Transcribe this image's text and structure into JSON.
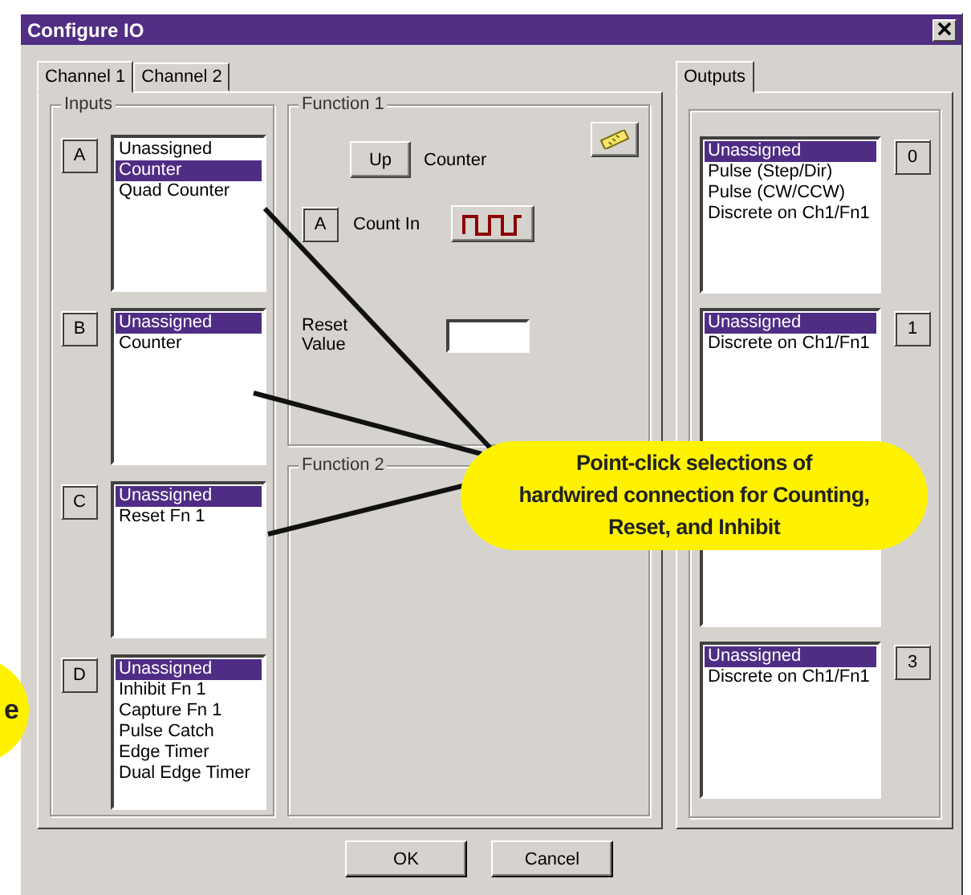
{
  "window": {
    "title": "Configure IO"
  },
  "tabs": [
    {
      "label": "Channel 1",
      "selected": true
    },
    {
      "label": "Channel 2",
      "selected": false
    }
  ],
  "inputs": {
    "title": "Inputs",
    "rows": [
      {
        "key": "A",
        "items": [
          {
            "label": "Unassigned",
            "selected": false
          },
          {
            "label": "Counter",
            "selected": true
          },
          {
            "label": "Quad Counter",
            "selected": false
          }
        ]
      },
      {
        "key": "B",
        "items": [
          {
            "label": "Unassigned",
            "selected": true
          },
          {
            "label": "Counter",
            "selected": false
          }
        ]
      },
      {
        "key": "C",
        "items": [
          {
            "label": "Unassigned",
            "selected": true
          },
          {
            "label": "Reset Fn 1",
            "selected": false
          }
        ]
      },
      {
        "key": "D",
        "items": [
          {
            "label": "Unassigned",
            "selected": true
          },
          {
            "label": "Inhibit Fn 1",
            "selected": false
          },
          {
            "label": "Capture Fn 1",
            "selected": false
          },
          {
            "label": "Pulse Catch",
            "selected": false
          },
          {
            "label": "Edge Timer",
            "selected": false
          },
          {
            "label": "Dual Edge Timer",
            "selected": false
          }
        ]
      }
    ]
  },
  "function_1": {
    "title": "Function 1",
    "direction_button": "Up",
    "mode": "Counter",
    "input_button": "A",
    "count_in_label": "Count In",
    "reset_label": "Reset Value"
  },
  "function_2": {
    "title": "Function 2"
  },
  "outputs_tab": {
    "label": "Outputs",
    "selected": true
  },
  "outputs": [
    {
      "covered": false,
      "key": "0",
      "items": [
        {
          "label": "Unassigned",
          "selected": true
        },
        {
          "label": "Pulse (Step/Dir)",
          "selected": false
        },
        {
          "label": "Pulse (CW/CCW)",
          "selected": false
        },
        {
          "label": "Discrete on Ch1/Fn1",
          "selected": false
        }
      ]
    },
    {
      "covered": false,
      "key": "1",
      "items": [
        {
          "label": "Unassigned",
          "selected": true
        },
        {
          "label": "Discrete on Ch1/Fn1",
          "selected": false
        }
      ]
    },
    {
      "covered": true
    },
    {
      "covered": false,
      "key": "3",
      "items": [
        {
          "label": "Unassigned",
          "selected": true
        },
        {
          "label": "Discrete on Ch1/Fn1",
          "selected": false
        }
      ]
    }
  ],
  "callouts": [
    {
      "text": "Point-click selections of\nhardwired connection for Counting,\nReset, and Inhibit"
    },
    {
      "text": "e"
    }
  ],
  "buttons": [
    "OK",
    "Cancel"
  ]
}
